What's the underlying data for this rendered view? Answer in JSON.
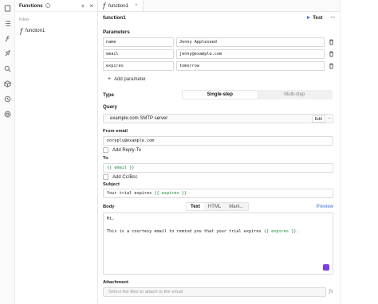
{
  "sidebar": {
    "title": "Functions",
    "filter_placeholder": "Filter",
    "items": [
      {
        "label": "function1"
      }
    ]
  },
  "tab": {
    "label": "function1"
  },
  "editor": {
    "title": "function1",
    "test_label": "Test",
    "parameters_label": "Parameters",
    "params": [
      {
        "name": "name",
        "value": "Jenny Appleseed"
      },
      {
        "name": "email",
        "value": "jenny@example.com"
      },
      {
        "name": "expires",
        "value": "tomorrow"
      }
    ],
    "add_parameter": "Add parameter",
    "type_label": "Type",
    "type_options": [
      "Single-step",
      "Multi-step"
    ],
    "type_selected": "Single-step",
    "query_label": "Query",
    "query_value": "example.com SMTP server",
    "edit_label": "Edit",
    "from_label": "From email",
    "from_value": "noreply@example.com",
    "reply_to_label": "Add Reply-To",
    "to_label": "To",
    "to_value": "{{ email }}",
    "cc_label": "Add Cc/Bcc",
    "subject_label": "Subject",
    "subject_prefix": "Your trial expires ",
    "subject_tmpl": "{{ expires }}",
    "body_label": "Body",
    "body_tabs": [
      "Text",
      "HTML",
      "Mark..."
    ],
    "body_selected": "Text",
    "preview_label": "Preview",
    "body_line1": "Hi,",
    "body_line2_prefix": "This is a courtesy email to remind you that your trial expires ",
    "body_line2_tmpl": "{{ expires }}",
    "body_line2_suffix": ".",
    "attachment_label": "Attachment",
    "attachment_placeholder": "Select the files to attach to the email"
  },
  "colors": {
    "accent": "#3b6fd8",
    "template": "#1a8a3a",
    "badge": "#7b3fe4"
  }
}
